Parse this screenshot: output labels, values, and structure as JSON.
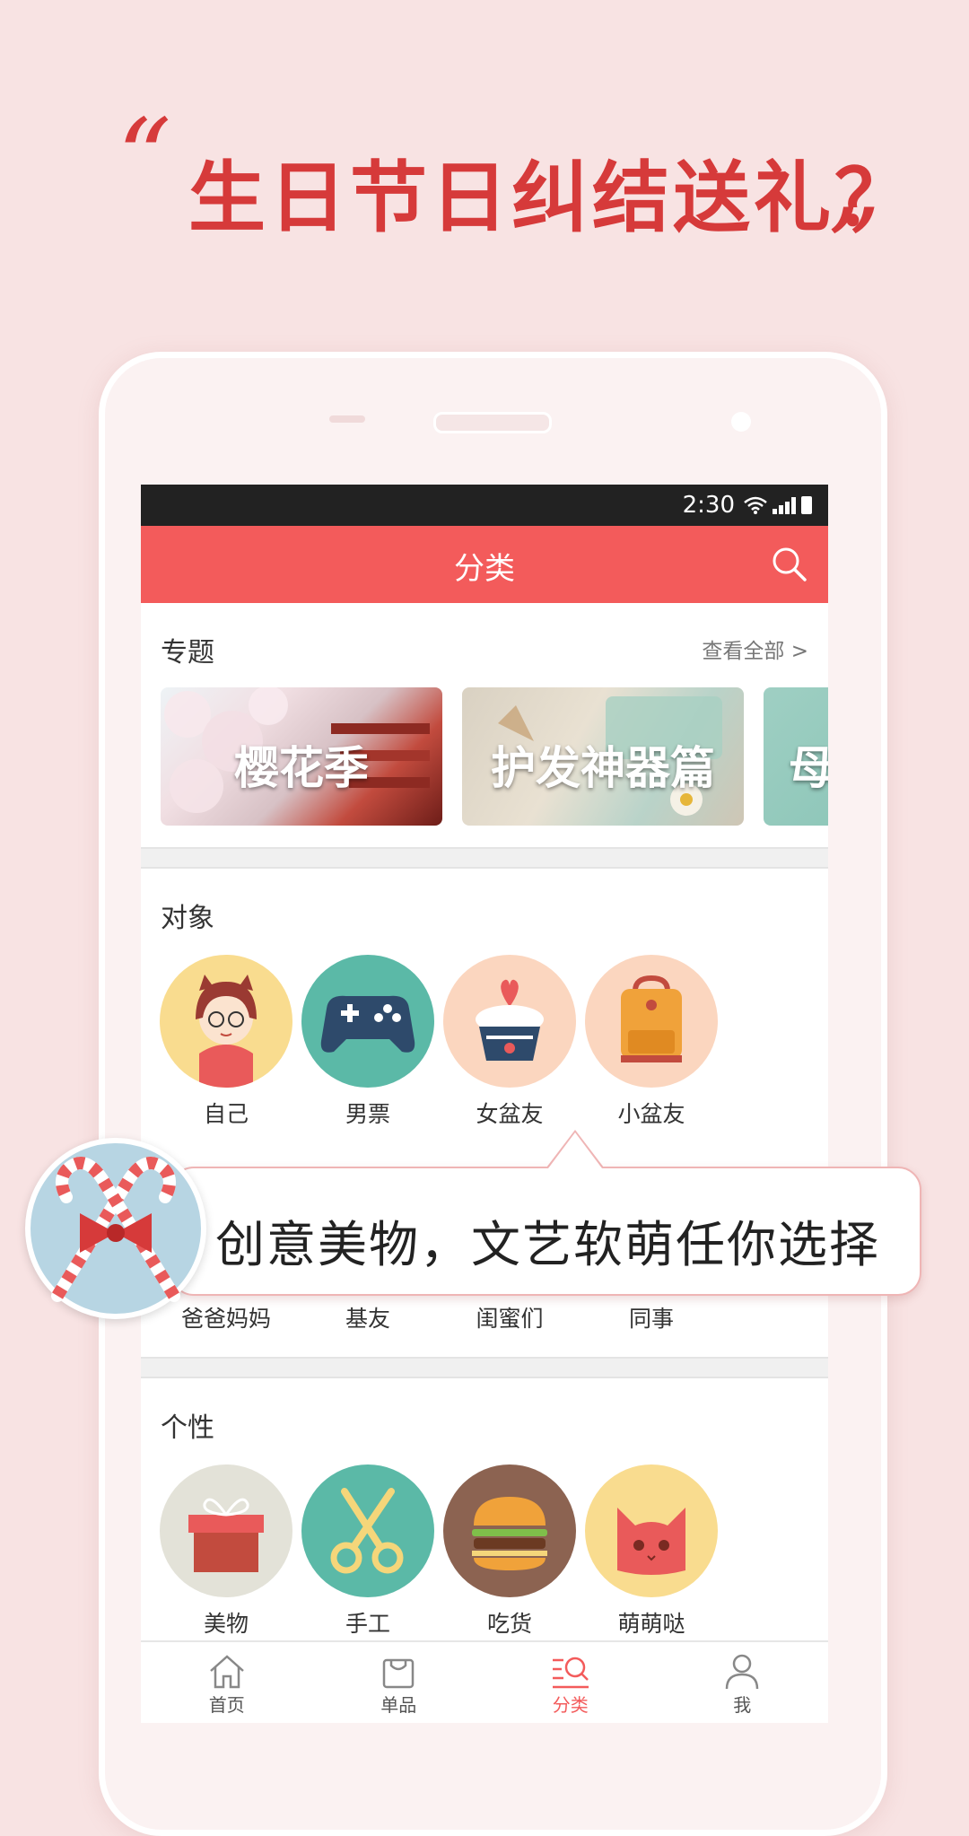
{
  "promo": {
    "headline": "生日节日纠结送礼？",
    "quote_open": "“",
    "quote_close": "”",
    "bubble_text": "创意美物，文艺软萌任你选择"
  },
  "status_bar": {
    "time": "2:30"
  },
  "app_bar": {
    "title": "分类"
  },
  "topics": {
    "title": "专题",
    "view_all": "查看全部 >",
    "cards": [
      {
        "label": "樱花季"
      },
      {
        "label": "护发神器篇"
      },
      {
        "label": "母"
      }
    ]
  },
  "recipients": {
    "title": "对象",
    "row1": [
      {
        "label": "自己",
        "color": "#f9dc8f"
      },
      {
        "label": "男票",
        "color": "#5bb9a7"
      },
      {
        "label": "女盆友",
        "color": "#fbd6bf"
      },
      {
        "label": "小盆友",
        "color": "#fbd6bf"
      }
    ],
    "row2": [
      {
        "label": "爸爸妈妈"
      },
      {
        "label": "基友"
      },
      {
        "label": "闺蜜们"
      },
      {
        "label": "同事"
      }
    ]
  },
  "personality": {
    "title": "个性",
    "items": [
      {
        "label": "美物",
        "color": "#e3e2d8"
      },
      {
        "label": "手工",
        "color": "#5bb9a7"
      },
      {
        "label": "吃货",
        "color": "#8c6351"
      },
      {
        "label": "萌萌哒",
        "color": "#f9dc8f"
      }
    ]
  },
  "bottom_nav": [
    {
      "label": "首页",
      "icon": "home-icon"
    },
    {
      "label": "单品",
      "icon": "shopping-bag-icon"
    },
    {
      "label": "分类",
      "icon": "category-search-icon",
      "active": true
    },
    {
      "label": "我",
      "icon": "user-icon"
    }
  ],
  "colors": {
    "accent": "#f35b5b",
    "headline": "#d63a3a",
    "background": "#f8e3e3"
  }
}
